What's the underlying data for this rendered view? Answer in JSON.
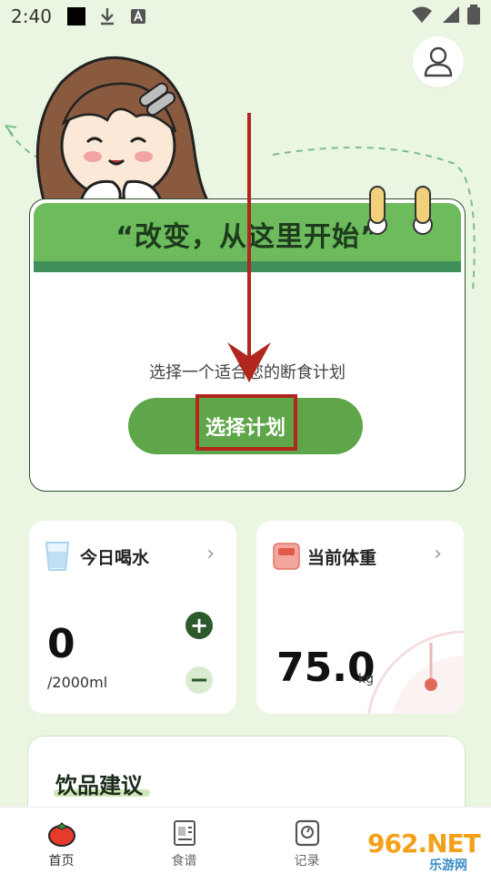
{
  "status_bar": {
    "time": "2:40"
  },
  "plan_card": {
    "slogan": "“改变，从这里开始”",
    "subtitle": "选择一个适合您的断食计划",
    "choose_button": "选择计划"
  },
  "water": {
    "title": "今日喝水",
    "value": "0",
    "goal": "/2000ml"
  },
  "weight": {
    "title": "当前体重",
    "value": "75.0",
    "unit": "kg"
  },
  "drinks": {
    "title": "饮品建议"
  },
  "nav": {
    "items": [
      {
        "label": "首页",
        "icon": "tomato-icon"
      },
      {
        "label": "食谱",
        "icon": "recipe-book-icon"
      },
      {
        "label": "记录",
        "icon": "scale-icon"
      },
      {
        "label": "",
        "icon": "hidden"
      }
    ]
  },
  "watermark": {
    "brand": "962.NET",
    "sub": "乐游网"
  },
  "colors": {
    "background": "#eaf6e1",
    "primary_green": "#5fa64a",
    "banner_green": "#6dbb5c",
    "highlight_red": "#b1261d"
  }
}
